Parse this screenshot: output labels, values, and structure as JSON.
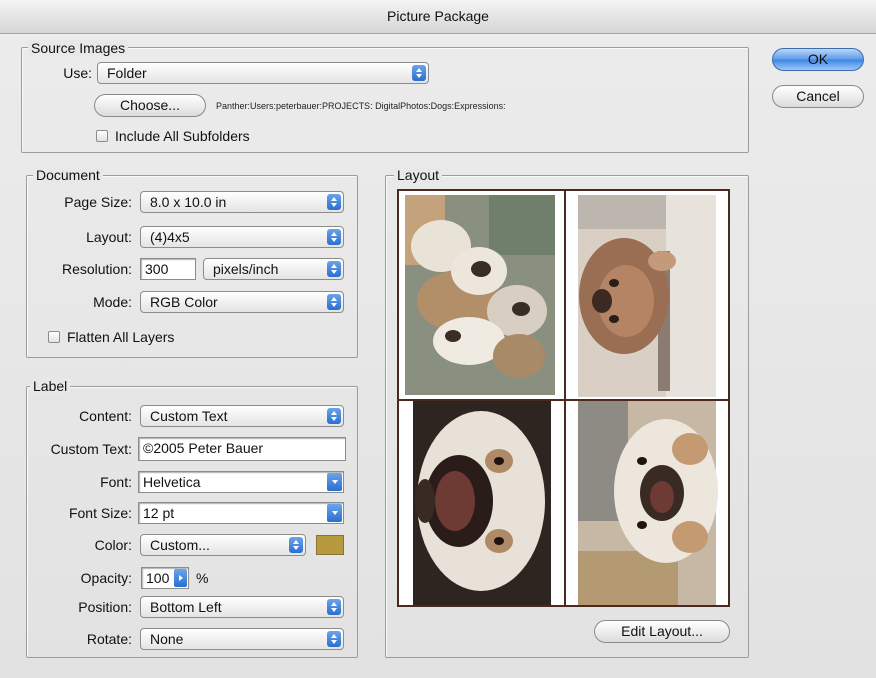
{
  "window": {
    "title": "Picture Package"
  },
  "buttons": {
    "ok": "OK",
    "cancel": "Cancel",
    "choose": "Choose...",
    "edit_layout": "Edit Layout..."
  },
  "source": {
    "legend": "Source Images",
    "use_label": "Use:",
    "use_value": "Folder",
    "path": "Panther:Users:peterbauer:PROJECTS: DigitalPhotos:Dogs:Expressions:",
    "include_subfolders_label": "Include All Subfolders",
    "include_subfolders_checked": false
  },
  "document": {
    "legend": "Document",
    "page_size_label": "Page Size:",
    "page_size_value": "8.0 x 10.0 in",
    "layout_label": "Layout:",
    "layout_value": "(4)4x5",
    "resolution_label": "Resolution:",
    "resolution_value": "300",
    "resolution_unit": "pixels/inch",
    "mode_label": "Mode:",
    "mode_value": "RGB Color",
    "flatten_label": "Flatten All Layers",
    "flatten_checked": false
  },
  "label": {
    "legend": "Label",
    "content_label": "Content:",
    "content_value": "Custom Text",
    "custom_text_label": "Custom Text:",
    "custom_text_value": "©2005 Peter Bauer",
    "font_label": "Font:",
    "font_value": "Helvetica",
    "font_size_label": "Font Size:",
    "font_size_value": "12 pt",
    "color_label": "Color:",
    "color_value": "Custom...",
    "color_swatch": "#b89a3e",
    "opacity_label": "Opacity:",
    "opacity_value": "100",
    "opacity_unit": "%",
    "position_label": "Position:",
    "position_value": "Bottom Left",
    "rotate_label": "Rotate:",
    "rotate_value": "None"
  },
  "layout_preview": {
    "legend": "Layout",
    "photos": [
      "bulldog-puppies-photo",
      "bulldog-lying-photo",
      "bulldog-open-mouth-photo",
      "bulldog-closeup-photo"
    ]
  },
  "colors": {
    "accent": "#3d85e2",
    "frame": "#4a2a20"
  }
}
